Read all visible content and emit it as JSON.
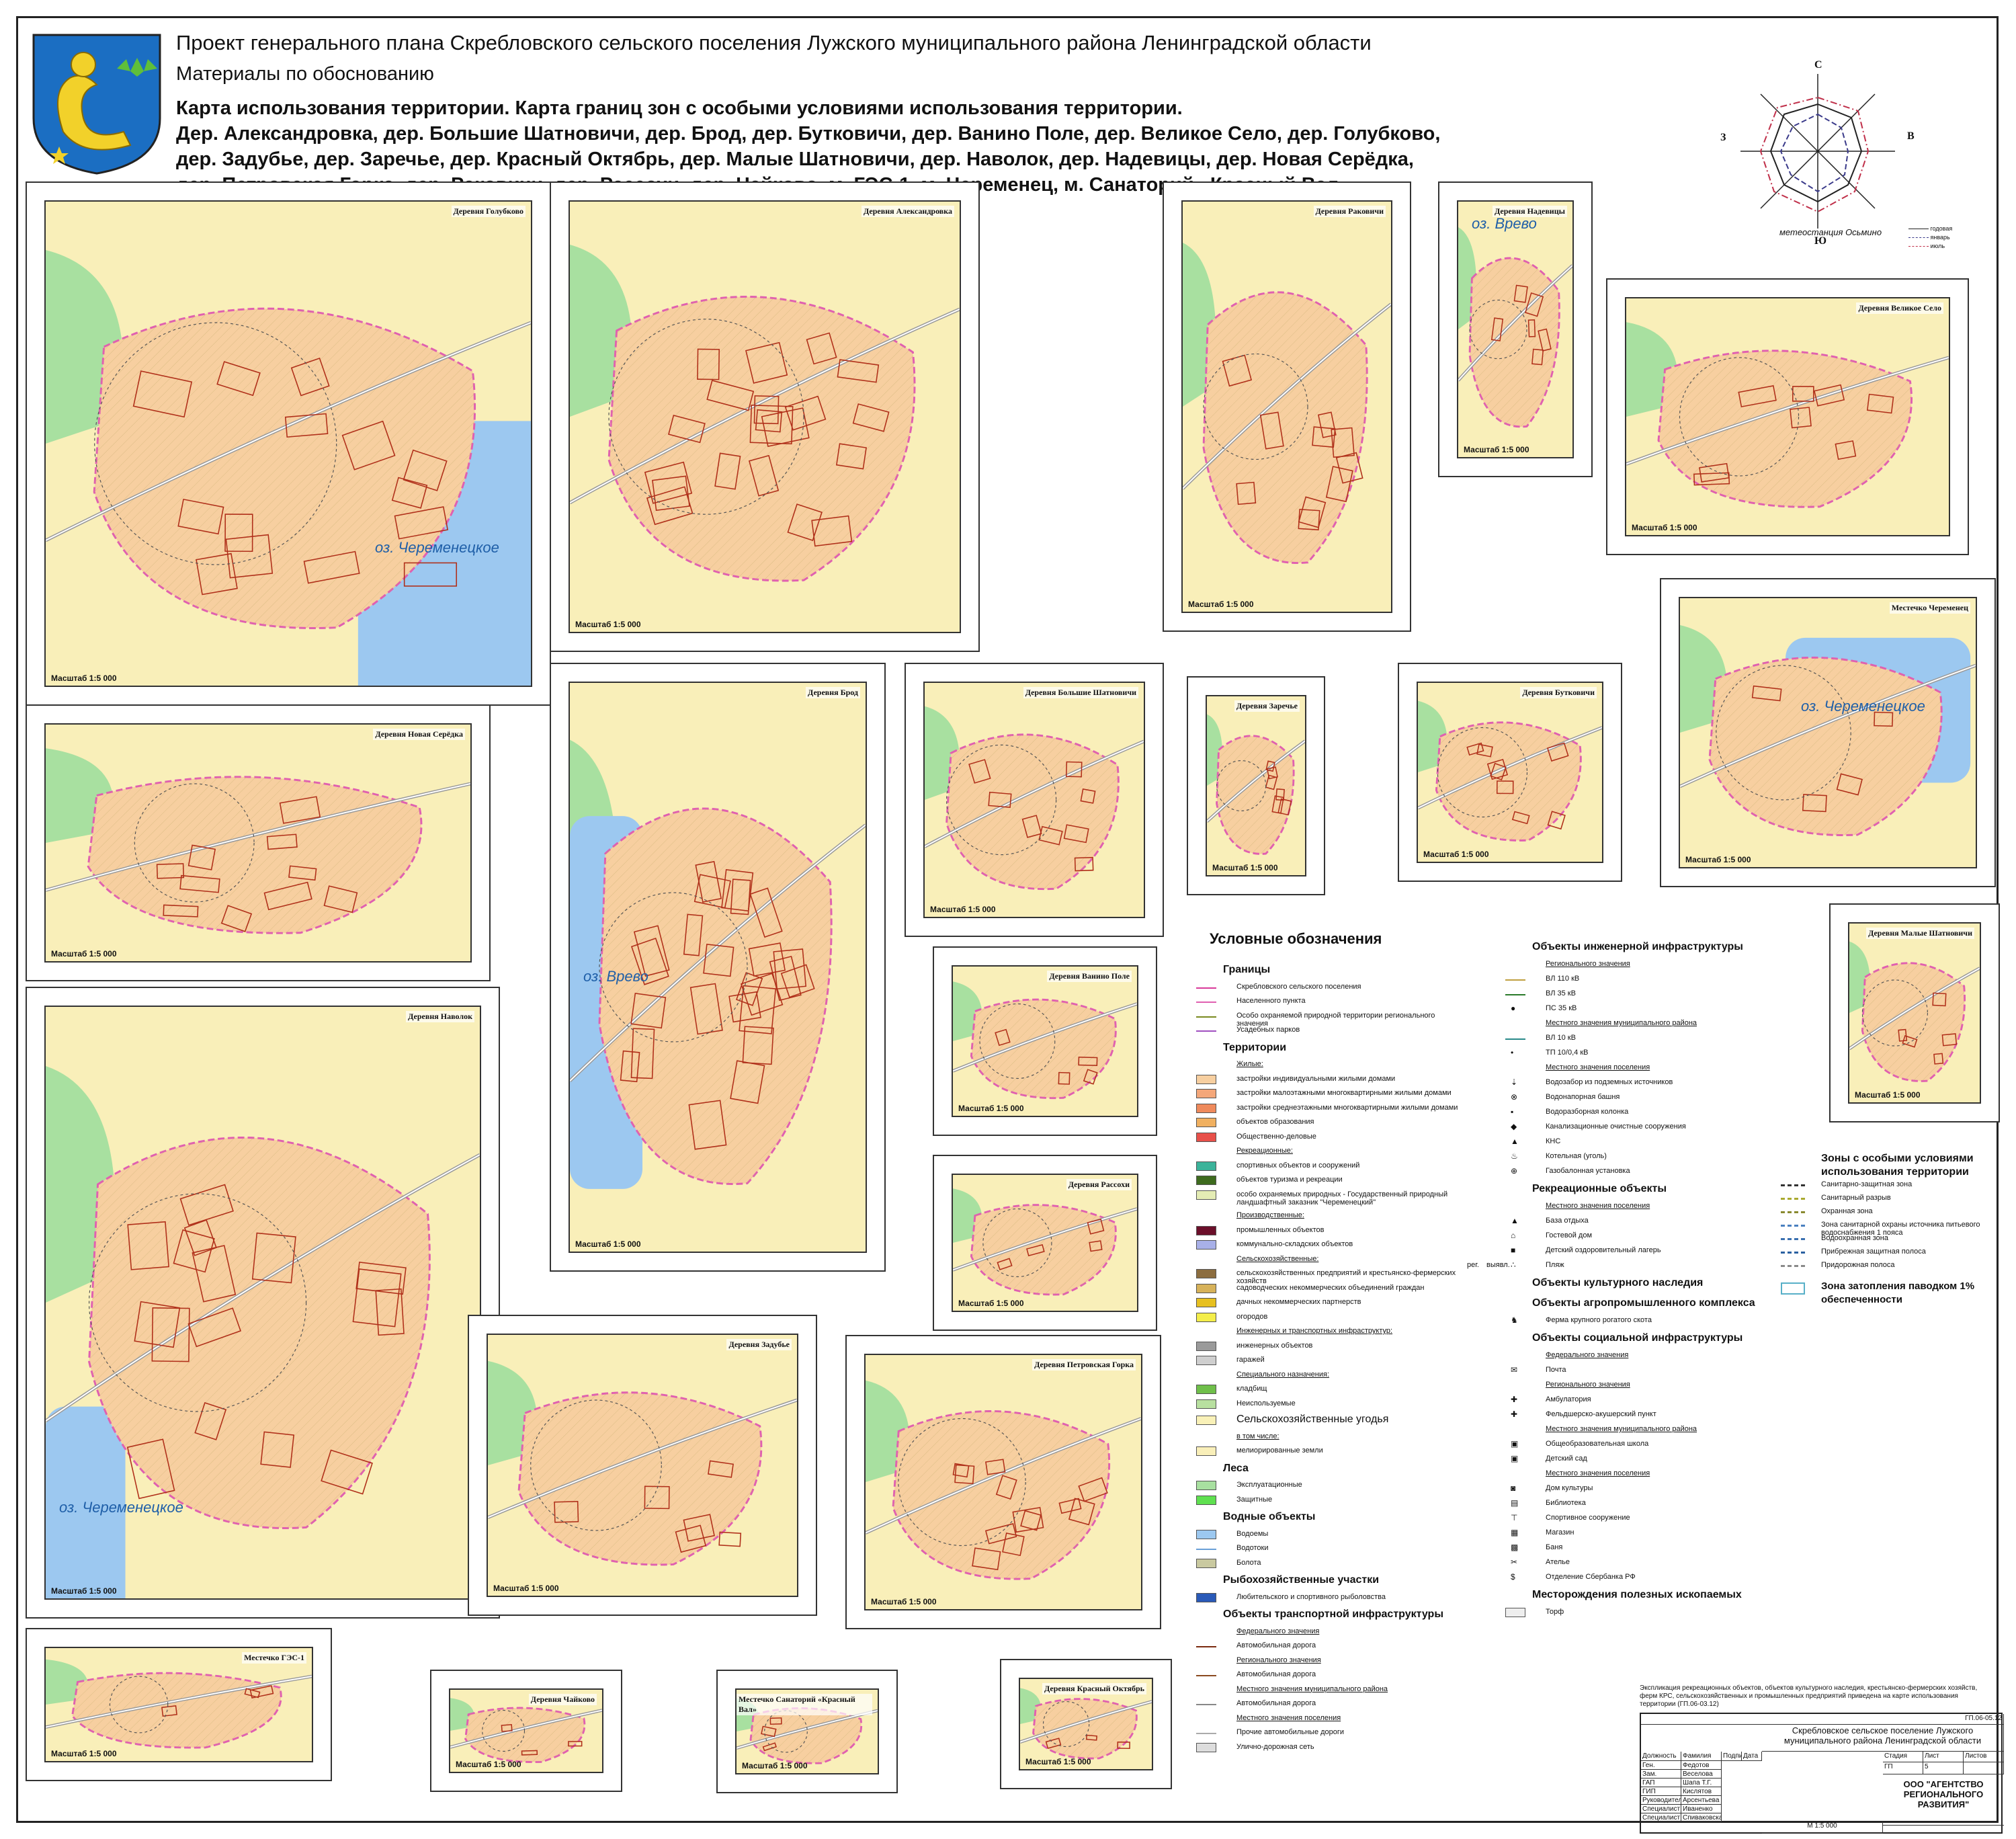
{
  "header": {
    "line1": "Проект генерального плана Скребловского сельского поселения Лужского муниципального района Ленинградской области",
    "line2": "Материалы по обоснованию",
    "line3": "Карта использования территории. Карта границ зон с особыми условиями использования территории.",
    "line4": "Дер. Александровка, дер. Большие Шатновичи, дер. Брод, дер. Бутковичи, дер. Ванино Поле, дер. Великое Село, дер. Голубково,",
    "line5": "дер. Задубье, дер. Заречье, дер. Красный Октябрь, дер. Малые Шатновичи, дер. Наволок, дер. Надевицы, дер. Новая Серёдка,",
    "line6": "дер. Петровская Горка, дер. Раковичи, дер. Рассохи, дер. Чайково, м. ГЭС-1, м. Череменец, м. Санаторий «Красный Вал»"
  },
  "wind_rose": {
    "n": "С",
    "s": "Ю",
    "w": "З",
    "e": "В",
    "station": "метеостанция Осьмино",
    "legend": [
      "годовая",
      "январь",
      "июль"
    ]
  },
  "scale_label": "Масштаб 1:5 000",
  "panels": [
    {
      "title": "Деревня Голубково",
      "lake": "оз. Череменецкое"
    },
    {
      "title": "Деревня Александровка"
    },
    {
      "title": "Деревня Раковичи"
    },
    {
      "title": "Деревня Надевицы",
      "lake": "оз. Врево"
    },
    {
      "title": "Деревня Великое Село"
    },
    {
      "title": "Местечко Череменец",
      "lake": "оз. Череменецкое"
    },
    {
      "title": "Деревня Новая Серёдка"
    },
    {
      "title": "Деревня Брод",
      "lake": "оз. Врево"
    },
    {
      "title": "Деревня Большие Шатновичи"
    },
    {
      "title": "Деревня Заречье"
    },
    {
      "title": "Деревня Бутковичи"
    },
    {
      "title": "Деревня Малые Шатновичи"
    },
    {
      "title": "Деревня Наволок",
      "lake": "оз. Череменецкое"
    },
    {
      "title": "Деревня Ванино Поле"
    },
    {
      "title": "Деревня Рассохи"
    },
    {
      "title": "Деревня Задубье"
    },
    {
      "title": "Деревня Петровская Горка"
    },
    {
      "title": "Местечко ГЭС-1"
    },
    {
      "title": "Деревня Чайково"
    },
    {
      "title": "Местечко Санаторий «Красный Вал»"
    },
    {
      "title": "Деревня Красный Октябрь"
    }
  ],
  "legend": {
    "title": "Условные обозначения",
    "col1": [
      {
        "kind": "section",
        "text": "Границы"
      },
      {
        "kind": "line",
        "text": "Скребловского сельского поселения",
        "color": "#d83a9a"
      },
      {
        "kind": "line",
        "text": "Населенного пункта",
        "color": "#e060b0"
      },
      {
        "kind": "line",
        "text": "Особо охраняемой природной территории регионального значения",
        "color": "#7a8a20"
      },
      {
        "kind": "line",
        "text": "Усадебных парков",
        "color": "#a050c0"
      },
      {
        "kind": "section",
        "text": "Территории"
      },
      {
        "kind": "sub",
        "text": "Жилые:"
      },
      {
        "kind": "fill",
        "text": "застройки индивидуальными жилыми домами",
        "color": "#f7cfa0"
      },
      {
        "kind": "fill",
        "text": "застройки малоэтажными многоквартирными жилыми домами",
        "color": "#f4a77a"
      },
      {
        "kind": "fill",
        "text": "застройки среднеэтажными многоквартирными жилыми домами",
        "color": "#ef8a5c"
      },
      {
        "kind": "fill",
        "text": "объектов образования",
        "color": "#f0b060"
      },
      {
        "kind": "fill",
        "text": "Общественно-деловые",
        "color": "#e8504a"
      },
      {
        "kind": "sub",
        "text": "Рекреационные:"
      },
      {
        "kind": "fill",
        "text": "спортивных объектов и сооружений",
        "color": "#3bb39a"
      },
      {
        "kind": "fill",
        "text": "объектов туризма и рекреации",
        "color": "#3e6b1e"
      },
      {
        "kind": "fill",
        "text": "особо охраняемых природных - Государственный природный ландшафтный заказник \"Череменецкий\"",
        "color": "#e4ecb4"
      },
      {
        "kind": "sub",
        "text": "Производственные:"
      },
      {
        "kind": "fill",
        "text": "промышленных объектов",
        "color": "#6b0f2a"
      },
      {
        "kind": "fill",
        "text": "коммунально-складских объектов",
        "color": "#a8b0e8"
      },
      {
        "kind": "sub",
        "text": "Сельскохозяйственные:"
      },
      {
        "kind": "fill",
        "text": "сельскохозяйственных предприятий и крестьянско-фермерских хозяйств",
        "color": "#8c6d3f"
      },
      {
        "kind": "fill",
        "text": "садоводческих некоммерческих объединений граждан",
        "color": "#d7b25a"
      },
      {
        "kind": "fill",
        "text": "дачных некоммерческих партнерств",
        "color": "#e7c020"
      },
      {
        "kind": "fill",
        "text": "огородов",
        "color": "#f4ee4a"
      },
      {
        "kind": "sub",
        "text": "Инженерных и транспортных инфраструктур:"
      },
      {
        "kind": "fill",
        "text": "инженерных объектов",
        "color": "#9a9a9a"
      },
      {
        "kind": "fill",
        "text": "гаражей",
        "color": "#cfcfcf"
      },
      {
        "kind": "sub",
        "text": "Специального назначения:"
      },
      {
        "kind": "fill",
        "text": "кладбищ",
        "color": "#6fbf4a"
      },
      {
        "kind": "fill",
        "text": "Неиспользуемые",
        "color": "#b8e0a0"
      },
      {
        "kind": "big",
        "text": "Сельскохозяйственные угодья",
        "color": "#f9f1b8"
      },
      {
        "kind": "sub",
        "text": "в том числе:"
      },
      {
        "kind": "fill",
        "text": "мелиорированные земли",
        "color": "#f9efb9"
      },
      {
        "kind": "section",
        "text": "Леса"
      },
      {
        "kind": "fill",
        "text": "Эксплуатационные",
        "color": "#a8e0a0"
      },
      {
        "kind": "fill",
        "text": "Защитные",
        "color": "#5fe050"
      },
      {
        "kind": "section",
        "text": "Водные объекты"
      },
      {
        "kind": "fill",
        "text": "Водоемы",
        "color": "#9cc8f0"
      },
      {
        "kind": "line",
        "text": "Водотоки",
        "color": "#6aa0d8"
      },
      {
        "kind": "fill",
        "text": "Болота",
        "color": "#c9c9a0"
      },
      {
        "kind": "section",
        "text": "Рыбохозяйственные участки"
      },
      {
        "kind": "fill",
        "text": "Любительского и спортивного рыболовства",
        "color": "#2a5ab8"
      },
      {
        "kind": "section",
        "text": "Объекты транспортной инфраструктуры"
      },
      {
        "kind": "sub",
        "text": "Федерального значения"
      },
      {
        "kind": "line",
        "text": "Автомобильная дорога",
        "color": "#7a2a10"
      },
      {
        "kind": "sub",
        "text": "Регионального значения"
      },
      {
        "kind": "line",
        "text": "Автомобильная дорога",
        "color": "#8a4a20"
      },
      {
        "kind": "sub",
        "text": "Местного значения муниципального района"
      },
      {
        "kind": "line",
        "text": "Автомобильная дорога",
        "color": "#888888"
      },
      {
        "kind": "sub",
        "text": "Местного значения поселения"
      },
      {
        "kind": "line",
        "text": "Прочие автомобильные дороги",
        "color": "#aaaaaa"
      },
      {
        "kind": "fill",
        "text": "Улично-дорожная сеть",
        "color": "#dddddd"
      }
    ],
    "col2": [
      {
        "kind": "section",
        "text": "Объекты инженерной инфраструктуры"
      },
      {
        "kind": "sub",
        "text": "Регионального значения"
      },
      {
        "kind": "line",
        "text": "ВЛ 110 кВ",
        "color": "#c0a040"
      },
      {
        "kind": "line",
        "text": "ВЛ 35 кВ",
        "color": "#2a7a2a"
      },
      {
        "kind": "sym",
        "text": "ПС 35 кВ",
        "symbol": "●"
      },
      {
        "kind": "sub",
        "text": "Местного значения муниципального района"
      },
      {
        "kind": "line",
        "text": "ВЛ 10 кВ",
        "color": "#2a8a8a"
      },
      {
        "kind": "sym",
        "text": "ТП 10/0,4 кВ",
        "symbol": "•"
      },
      {
        "kind": "sub",
        "text": "Местного значения поселения"
      },
      {
        "kind": "sym",
        "text": "Водозабор из подземных источников",
        "symbol": "⇣"
      },
      {
        "kind": "sym",
        "text": "Водонапорная башня",
        "symbol": "⊗"
      },
      {
        "kind": "sym",
        "text": "Водоразборная колонка",
        "symbol": "▪"
      },
      {
        "kind": "sym",
        "text": "Канализационные очистные сооружения",
        "symbol": "◆"
      },
      {
        "kind": "sym",
        "text": "КНС",
        "symbol": "▲"
      },
      {
        "kind": "sym",
        "text": "Котельная (уголь)",
        "symbol": "♨"
      },
      {
        "kind": "sym",
        "text": "Газобалонная установка",
        "symbol": "⊕"
      },
      {
        "kind": "section",
        "text": "Рекреационные объекты"
      },
      {
        "kind": "sub",
        "text": "Местного значения поселения"
      },
      {
        "kind": "sym",
        "text": "База отдыха",
        "symbol": "▲"
      },
      {
        "kind": "sym",
        "text": "Гостевой дом",
        "symbol": "⌂"
      },
      {
        "kind": "sym",
        "text": "Детский оздоровительный лагерь",
        "symbol": "■"
      },
      {
        "kind": "sym",
        "text": "Пляж",
        "symbol": "∴"
      },
      {
        "kind": "section",
        "text": "Объекты культурного наследия"
      },
      {
        "kind": "section",
        "text": "Объекты агропромышленного комплекса"
      },
      {
        "kind": "sym",
        "text": "Ферма крупного рогатого скота",
        "symbol": "♞"
      },
      {
        "kind": "section",
        "text": "Объекты социальной инфраструктуры"
      },
      {
        "kind": "sub",
        "text": "Федерального значения"
      },
      {
        "kind": "sym",
        "text": "Почта",
        "symbol": "✉"
      },
      {
        "kind": "sub",
        "text": "Регионального значения"
      },
      {
        "kind": "sym",
        "text": "Амбулатория",
        "symbol": "✚"
      },
      {
        "kind": "sym",
        "text": "Фельдшерско-акушерский пункт",
        "symbol": "✚"
      },
      {
        "kind": "sub",
        "text": "Местного значения муниципального района"
      },
      {
        "kind": "sym",
        "text": "Общеобразовательная школа",
        "symbol": "▣"
      },
      {
        "kind": "sym",
        "text": "Детский сад",
        "symbol": "▣"
      },
      {
        "kind": "sub",
        "text": "Местного значения поселения"
      },
      {
        "kind": "sym",
        "text": "Дом культуры",
        "symbol": "◙"
      },
      {
        "kind": "sym",
        "text": "Библиотека",
        "symbol": "▤"
      },
      {
        "kind": "sym",
        "text": "Спортивное сооружение",
        "symbol": "⊤"
      },
      {
        "kind": "sym",
        "text": "Магазин",
        "symbol": "▦"
      },
      {
        "kind": "sym",
        "text": "Баня",
        "symbol": "▩"
      },
      {
        "kind": "sym",
        "text": "Ателье",
        "symbol": "✂"
      },
      {
        "kind": "sym",
        "text": "Отделение Сбербанка РФ",
        "symbol": "$"
      },
      {
        "kind": "section",
        "text": "Месторождения полезных ископаемых"
      },
      {
        "kind": "fill",
        "text": "Торф",
        "color": "#eeeeee"
      }
    ],
    "col3_title": "Зоны с особыми условиями использования территории",
    "col3": [
      {
        "text": "Санитарно-защитная зона",
        "color": "#333333"
      },
      {
        "text": "Санитарный разрыв",
        "color": "#aaaa30"
      },
      {
        "text": "Охранная зона",
        "color": "#8a8a30"
      },
      {
        "text": "Зона санитарной охраны источника питьевого водоснабжения 1 пояса",
        "color": "#4a80c0"
      },
      {
        "text": "Водоохранная зона",
        "color": "#3a70b0"
      },
      {
        "text": "Прибрежная защитная полоса",
        "color": "#2a60a0"
      },
      {
        "text": "Придорожная полоса",
        "color": "#8a8a8a"
      }
    ],
    "flood_label": "Зона затопления паводком 1% обеспеченности",
    "regional_label": "рег.",
    "local_label": "выявл."
  },
  "explication": "Экспликация рекреационных объектов, объектов культурного наследия, крестьянско-фермерских хозяйств, ферм КРС, сельскохозяйственных и промышленных предприятий приведена на карте использования территории (ГП.06-03.12)",
  "stamp": {
    "code": "ГП.06-05.12",
    "org_title": "Скребловское сельское поселение Лужского муниципального района Ленинградской области",
    "stage_label": "Стадия",
    "sheet_label": "Лист",
    "sheets_label": "Листов",
    "stage": "ГП",
    "sheet": "5",
    "scale": "М 1:5 000",
    "company": "ООО \"АГЕНТСТВО РЕГИОНАЛЬНОГО РАЗВИТИЯ\"",
    "cols": [
      "Должность",
      "Фамилия",
      "Подпись",
      "Дата"
    ],
    "rows": [
      [
        "Ген. директор",
        "Федотов К.В."
      ],
      [
        "Зам. директора",
        "Веселова Е.А."
      ],
      [
        "ГАП",
        "Шапа Т.Г."
      ],
      [
        "ГИП",
        "Кислятов А.М."
      ],
      [
        "Руководитель проекта",
        "Арсентьева А.О."
      ],
      [
        "Специалист",
        "Иваненко Н.И."
      ],
      [
        "Специалист",
        "Спиваковская А.Ю."
      ]
    ]
  },
  "colors": {
    "residential": "#f7cfa0",
    "agri": "#f9efb9",
    "water": "#9cc8f0",
    "forest_protect": "#5fe050",
    "forest_exploit": "#a8e0a0",
    "farm": "#8c6d3f",
    "dacha": "#e7c020",
    "border_settlement": "#e060b0"
  }
}
